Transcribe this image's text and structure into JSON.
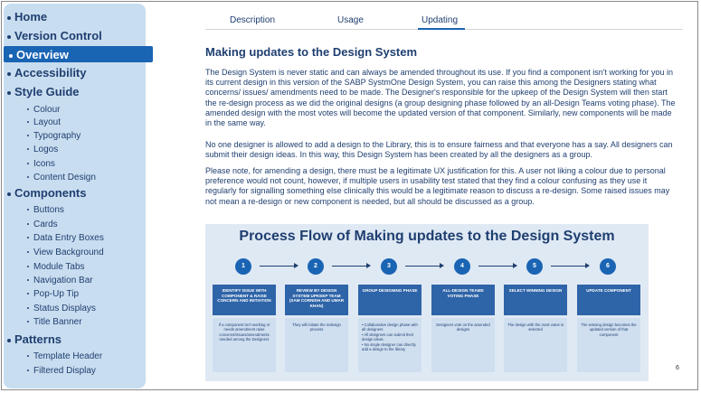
{
  "sidebar": {
    "main": [
      {
        "label": "Home"
      },
      {
        "label": "Version Control"
      },
      {
        "label": "Overview",
        "active": true
      },
      {
        "label": "Accessibility"
      },
      {
        "label": "Style Guide"
      },
      {
        "label": "Components"
      },
      {
        "label": "Patterns"
      }
    ],
    "style_guide_items": [
      "Colour",
      "Layout",
      "Typography",
      "Logos",
      "Icons",
      "Content Design"
    ],
    "component_items": [
      "Buttons",
      "Cards",
      "Data Entry Boxes",
      "View Background",
      "Module Tabs",
      "Navigation Bar",
      "Pop-Up Tip",
      "Status Displays",
      "Title Banner"
    ],
    "pattern_items": [
      "Template Header",
      "Filtered Display"
    ]
  },
  "tabs": [
    {
      "label": "Description"
    },
    {
      "label": "Usage"
    },
    {
      "label": "Updating",
      "active": true
    }
  ],
  "content": {
    "title": "Making updates to the Design System",
    "p1": "The Design System is never static and can always be amended throughout its use. If you find a component isn't working for you in its current design in this version of the SABP SystmOne Design System, you can raise this among the Designers stating what concerns/ issues/ amendments need to be made. The Designer's responsible for the upkeep of the Design System will then start the re-design process as we did the original designs (a group designing phase followed by an all-Design Teams voting phase). The amended design with the most votes will become the updated version of that component. Similarly, new components will be made in the same way.",
    "p2": "No one designer is allowed to add a design to the Library, this is to ensure fairness and that everyone has a say. All designers can submit their design ideas. In this way, this Design System has been created by all the designers as a group.",
    "p3": "Please note, for amending a design, there must be a legitimate UX justification for this. A user not liking a colour due to personal preference would not count, however, if multiple users in usability test stated that they find a colour confusing as they use it regularly for signalling something else clinically this would be a legitimate reason to discuss a re-design. Some raised issues may not mean a re-design or new component is needed, but all should be discussed as a group."
  },
  "diagram": {
    "title": "Process Flow of Making updates to the Design System",
    "steps": [
      {
        "num": "1",
        "heading": "IDENTIFY ISSUE WITH COMPONENT & RAISE CONCERN AND INITIATION",
        "desc": "If a component isn't working or needs amendment raise concerns/issues/amendments needed among the Designers"
      },
      {
        "num": "2",
        "heading": "REVIEW BY DESIGN SYSTEM UPKEEP TEAM (SAM CORNISH AND UMAR KHAN)",
        "desc": "They will initiate the redesign process"
      },
      {
        "num": "3",
        "heading": "GROUP DESIGNING PHASE",
        "bullets": [
          "Collaborative design phase with all designers",
          "All designers can submit their design ideas.",
          "No single designer can directly add a design to the library"
        ]
      },
      {
        "num": "4",
        "heading": "ALL-DESIGN TEAMS VOTING PHASE",
        "desc": "Designers vote on the amended designs"
      },
      {
        "num": "5",
        "heading": "SELECT WINNING DESIGN",
        "desc": "The design with the most votes is selected"
      },
      {
        "num": "6",
        "heading": "UPDATE COMPONENT",
        "desc": "The winning design becomes the updated version of that component"
      }
    ]
  },
  "page_number": "6"
}
